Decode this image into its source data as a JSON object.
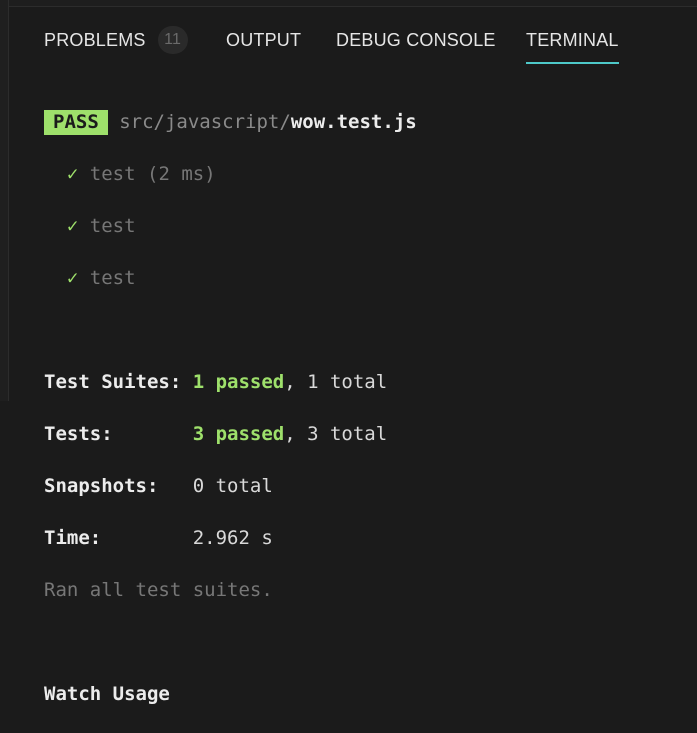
{
  "tabs": {
    "problems": "PROBLEMS",
    "problems_count": "11",
    "output": "OUTPUT",
    "debug": "DEBUG CONSOLE",
    "terminal": "TERMINAL"
  },
  "terminal": {
    "pass_badge": "PASS",
    "path_prefix": "src/javascript/",
    "file_name": "wow.test.js",
    "check_mark": "✓",
    "tests": [
      {
        "name": "test",
        "time": " (2 ms)"
      },
      {
        "name": "test",
        "time": ""
      },
      {
        "name": "test",
        "time": ""
      }
    ],
    "summary": {
      "suites_label": "Test Suites: ",
      "suites_passed": "1 passed",
      "suites_rest": ", 1 total",
      "tests_label": "Tests:       ",
      "tests_passed": "3 passed",
      "tests_rest": ", 3 total",
      "snapshots_label": "Snapshots:   ",
      "snapshots_value": "0 total",
      "time_label": "Time:        ",
      "time_value": "2.962 s",
      "ran_all": "Ran all test suites."
    },
    "watch_usage": "Watch Usage"
  },
  "colors": {
    "background": "#1b1b1b",
    "pass_green": "#9ee06b",
    "active_tab_underline": "#4ec9c9"
  }
}
